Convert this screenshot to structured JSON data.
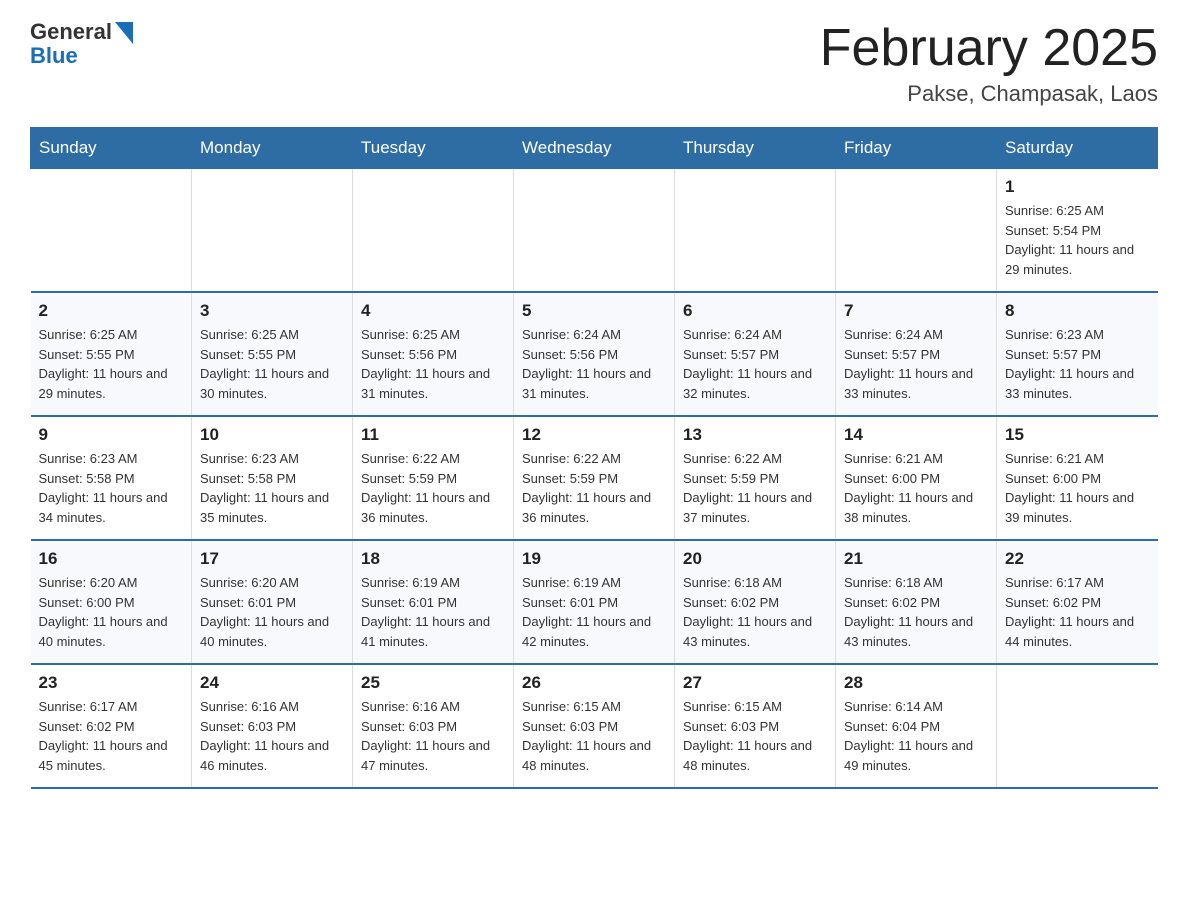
{
  "header": {
    "logo_general": "General",
    "logo_blue": "Blue",
    "month_title": "February 2025",
    "location": "Pakse, Champasak, Laos"
  },
  "weekdays": [
    "Sunday",
    "Monday",
    "Tuesday",
    "Wednesday",
    "Thursday",
    "Friday",
    "Saturday"
  ],
  "weeks": [
    [
      {
        "day": "",
        "sunrise": "",
        "sunset": "",
        "daylight": ""
      },
      {
        "day": "",
        "sunrise": "",
        "sunset": "",
        "daylight": ""
      },
      {
        "day": "",
        "sunrise": "",
        "sunset": "",
        "daylight": ""
      },
      {
        "day": "",
        "sunrise": "",
        "sunset": "",
        "daylight": ""
      },
      {
        "day": "",
        "sunrise": "",
        "sunset": "",
        "daylight": ""
      },
      {
        "day": "",
        "sunrise": "",
        "sunset": "",
        "daylight": ""
      },
      {
        "day": "1",
        "sunrise": "Sunrise: 6:25 AM",
        "sunset": "Sunset: 5:54 PM",
        "daylight": "Daylight: 11 hours and 29 minutes."
      }
    ],
    [
      {
        "day": "2",
        "sunrise": "Sunrise: 6:25 AM",
        "sunset": "Sunset: 5:55 PM",
        "daylight": "Daylight: 11 hours and 29 minutes."
      },
      {
        "day": "3",
        "sunrise": "Sunrise: 6:25 AM",
        "sunset": "Sunset: 5:55 PM",
        "daylight": "Daylight: 11 hours and 30 minutes."
      },
      {
        "day": "4",
        "sunrise": "Sunrise: 6:25 AM",
        "sunset": "Sunset: 5:56 PM",
        "daylight": "Daylight: 11 hours and 31 minutes."
      },
      {
        "day": "5",
        "sunrise": "Sunrise: 6:24 AM",
        "sunset": "Sunset: 5:56 PM",
        "daylight": "Daylight: 11 hours and 31 minutes."
      },
      {
        "day": "6",
        "sunrise": "Sunrise: 6:24 AM",
        "sunset": "Sunset: 5:57 PM",
        "daylight": "Daylight: 11 hours and 32 minutes."
      },
      {
        "day": "7",
        "sunrise": "Sunrise: 6:24 AM",
        "sunset": "Sunset: 5:57 PM",
        "daylight": "Daylight: 11 hours and 33 minutes."
      },
      {
        "day": "8",
        "sunrise": "Sunrise: 6:23 AM",
        "sunset": "Sunset: 5:57 PM",
        "daylight": "Daylight: 11 hours and 33 minutes."
      }
    ],
    [
      {
        "day": "9",
        "sunrise": "Sunrise: 6:23 AM",
        "sunset": "Sunset: 5:58 PM",
        "daylight": "Daylight: 11 hours and 34 minutes."
      },
      {
        "day": "10",
        "sunrise": "Sunrise: 6:23 AM",
        "sunset": "Sunset: 5:58 PM",
        "daylight": "Daylight: 11 hours and 35 minutes."
      },
      {
        "day": "11",
        "sunrise": "Sunrise: 6:22 AM",
        "sunset": "Sunset: 5:59 PM",
        "daylight": "Daylight: 11 hours and 36 minutes."
      },
      {
        "day": "12",
        "sunrise": "Sunrise: 6:22 AM",
        "sunset": "Sunset: 5:59 PM",
        "daylight": "Daylight: 11 hours and 36 minutes."
      },
      {
        "day": "13",
        "sunrise": "Sunrise: 6:22 AM",
        "sunset": "Sunset: 5:59 PM",
        "daylight": "Daylight: 11 hours and 37 minutes."
      },
      {
        "day": "14",
        "sunrise": "Sunrise: 6:21 AM",
        "sunset": "Sunset: 6:00 PM",
        "daylight": "Daylight: 11 hours and 38 minutes."
      },
      {
        "day": "15",
        "sunrise": "Sunrise: 6:21 AM",
        "sunset": "Sunset: 6:00 PM",
        "daylight": "Daylight: 11 hours and 39 minutes."
      }
    ],
    [
      {
        "day": "16",
        "sunrise": "Sunrise: 6:20 AM",
        "sunset": "Sunset: 6:00 PM",
        "daylight": "Daylight: 11 hours and 40 minutes."
      },
      {
        "day": "17",
        "sunrise": "Sunrise: 6:20 AM",
        "sunset": "Sunset: 6:01 PM",
        "daylight": "Daylight: 11 hours and 40 minutes."
      },
      {
        "day": "18",
        "sunrise": "Sunrise: 6:19 AM",
        "sunset": "Sunset: 6:01 PM",
        "daylight": "Daylight: 11 hours and 41 minutes."
      },
      {
        "day": "19",
        "sunrise": "Sunrise: 6:19 AM",
        "sunset": "Sunset: 6:01 PM",
        "daylight": "Daylight: 11 hours and 42 minutes."
      },
      {
        "day": "20",
        "sunrise": "Sunrise: 6:18 AM",
        "sunset": "Sunset: 6:02 PM",
        "daylight": "Daylight: 11 hours and 43 minutes."
      },
      {
        "day": "21",
        "sunrise": "Sunrise: 6:18 AM",
        "sunset": "Sunset: 6:02 PM",
        "daylight": "Daylight: 11 hours and 43 minutes."
      },
      {
        "day": "22",
        "sunrise": "Sunrise: 6:17 AM",
        "sunset": "Sunset: 6:02 PM",
        "daylight": "Daylight: 11 hours and 44 minutes."
      }
    ],
    [
      {
        "day": "23",
        "sunrise": "Sunrise: 6:17 AM",
        "sunset": "Sunset: 6:02 PM",
        "daylight": "Daylight: 11 hours and 45 minutes."
      },
      {
        "day": "24",
        "sunrise": "Sunrise: 6:16 AM",
        "sunset": "Sunset: 6:03 PM",
        "daylight": "Daylight: 11 hours and 46 minutes."
      },
      {
        "day": "25",
        "sunrise": "Sunrise: 6:16 AM",
        "sunset": "Sunset: 6:03 PM",
        "daylight": "Daylight: 11 hours and 47 minutes."
      },
      {
        "day": "26",
        "sunrise": "Sunrise: 6:15 AM",
        "sunset": "Sunset: 6:03 PM",
        "daylight": "Daylight: 11 hours and 48 minutes."
      },
      {
        "day": "27",
        "sunrise": "Sunrise: 6:15 AM",
        "sunset": "Sunset: 6:03 PM",
        "daylight": "Daylight: 11 hours and 48 minutes."
      },
      {
        "day": "28",
        "sunrise": "Sunrise: 6:14 AM",
        "sunset": "Sunset: 6:04 PM",
        "daylight": "Daylight: 11 hours and 49 minutes."
      },
      {
        "day": "",
        "sunrise": "",
        "sunset": "",
        "daylight": ""
      }
    ]
  ]
}
